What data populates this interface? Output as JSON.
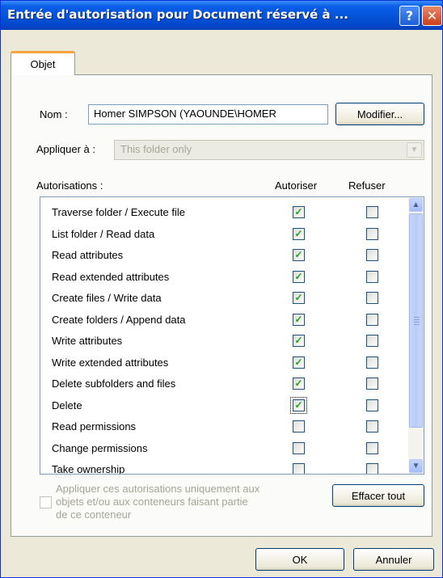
{
  "window": {
    "title": "Entrée d'autorisation pour Document réservé à ...",
    "help_glyph": "?",
    "close_glyph": "✕"
  },
  "tabs": [
    {
      "label": "Objet"
    }
  ],
  "name": {
    "label": "Nom :",
    "value": "Homer SIMPSON (YAOUNDE\\HOMER",
    "modify_button": "Modifier..."
  },
  "apply_to": {
    "label": "Appliquer à :",
    "selected": "This folder only"
  },
  "permissions": {
    "header": "Autorisations :",
    "col_allow": "Autoriser",
    "col_deny": "Refuser",
    "rows": [
      {
        "label": "Traverse folder / Execute file",
        "allow": true,
        "deny": false
      },
      {
        "label": "List folder / Read data",
        "allow": true,
        "deny": false
      },
      {
        "label": "Read attributes",
        "allow": true,
        "deny": false
      },
      {
        "label": "Read extended attributes",
        "allow": true,
        "deny": false
      },
      {
        "label": "Create files / Write data",
        "allow": true,
        "deny": false
      },
      {
        "label": "Create folders / Append data",
        "allow": true,
        "deny": false
      },
      {
        "label": "Write attributes",
        "allow": true,
        "deny": false
      },
      {
        "label": "Write extended attributes",
        "allow": true,
        "deny": false
      },
      {
        "label": "Delete subfolders and files",
        "allow": true,
        "deny": false
      },
      {
        "label": "Delete",
        "allow": true,
        "deny": false
      },
      {
        "label": "Read permissions",
        "allow": false,
        "deny": false
      },
      {
        "label": "Change permissions",
        "allow": false,
        "deny": false
      },
      {
        "label": "Take ownership",
        "allow": false,
        "deny": false
      }
    ]
  },
  "apply_inherit": {
    "checked": false,
    "line1": "Appliquer ces autorisations uniquement aux",
    "line2": "objets et/ou aux conteneurs faisant partie",
    "line3": "de ce conteneur"
  },
  "buttons": {
    "clear_all": "Effacer tout",
    "ok": "OK",
    "cancel": "Annuler"
  },
  "icons": {
    "check": "✓",
    "scroll_up": "▲",
    "scroll_down": "▼",
    "dropdown": "▼"
  },
  "colors": {
    "titlebar": "#0453d8",
    "tab_highlight": "#f3a53b",
    "checkmark": "#21a121"
  }
}
